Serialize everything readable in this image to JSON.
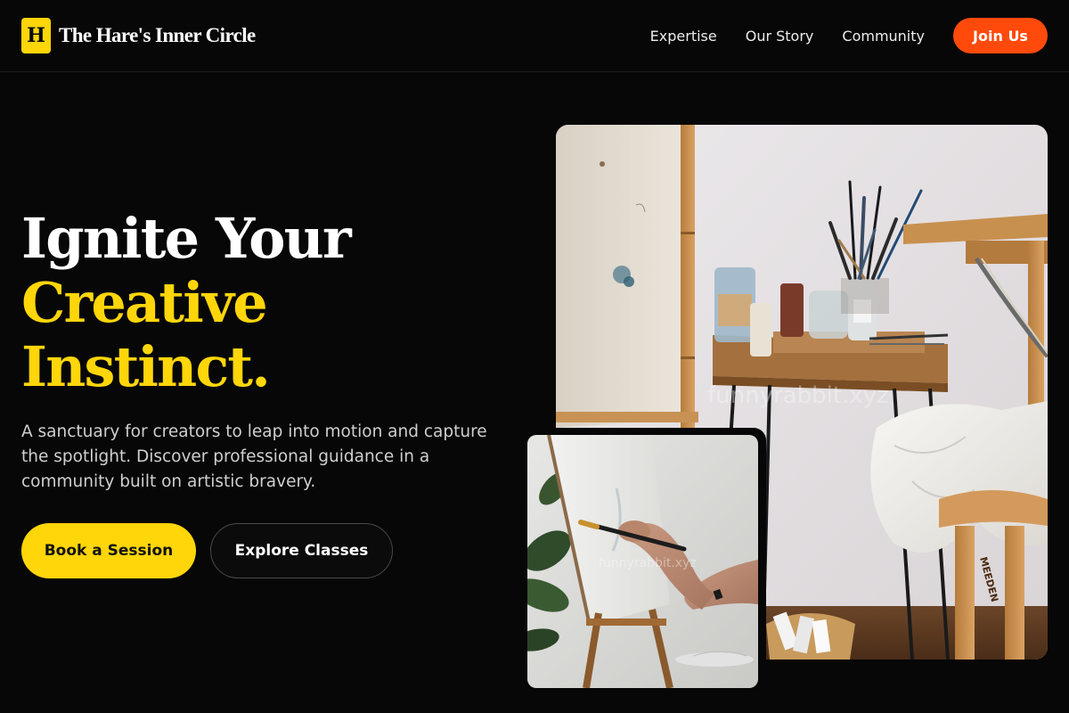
{
  "header": {
    "logo_letter": "H",
    "brand_name": "The Hare's Inner Circle",
    "nav": [
      "Expertise",
      "Our Story",
      "Community"
    ],
    "cta_label": "Join Us"
  },
  "hero": {
    "title_line1": "Ignite Your",
    "title_line2": "Creative",
    "title_line3": "Instinct.",
    "description": "A sanctuary for creators to leap into motion and capture the spotlight. Discover professional guidance in a community built on artistic bravery.",
    "primary_cta": "Book a Session",
    "secondary_cta": "Explore Classes"
  },
  "images": {
    "main_watermark": "funnyrabbit.xyz",
    "inset_watermark": "funnyrabbit.xyz",
    "stool_brand": "MEEDEN"
  },
  "colors": {
    "background": "#070707",
    "accent_yellow": "#ffd60a",
    "accent_orange": "#ff4a0c"
  }
}
